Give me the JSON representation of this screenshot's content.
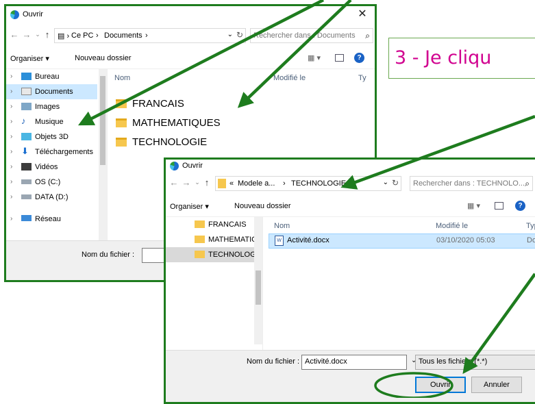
{
  "callout_text": "3 - Je cliqu",
  "dialog_back": {
    "title": "Ouvrir",
    "breadcrumb": [
      "Ce PC",
      "Documents"
    ],
    "search_placeholder": "Rechercher dans : Documents",
    "toolbar": {
      "organize": "Organiser ▾",
      "new_folder": "Nouveau dossier"
    },
    "nav_items": [
      {
        "label": "Bureau",
        "icon": "desktop-icon"
      },
      {
        "label": "Documents",
        "icon": "documents-icon",
        "selected": true
      },
      {
        "label": "Images",
        "icon": "pictures-icon"
      },
      {
        "label": "Musique",
        "icon": "music-icon"
      },
      {
        "label": "Objets 3D",
        "icon": "objects3d-icon"
      },
      {
        "label": "Téléchargements",
        "icon": "downloads-icon"
      },
      {
        "label": "Vidéos",
        "icon": "videos-icon"
      },
      {
        "label": "OS (C:)",
        "icon": "drive-icon"
      },
      {
        "label": "DATA (D:)",
        "icon": "drive-icon"
      },
      {
        "label": "Réseau",
        "icon": "network-icon"
      }
    ],
    "columns": {
      "name": "Nom",
      "modified": "Modifié le",
      "type": "Ty"
    },
    "folders": [
      "FRANCAIS",
      "MATHEMATIQUES",
      "TECHNOLOGIE"
    ],
    "footer": {
      "filename_label": "Nom du fichier :"
    }
  },
  "dialog_front": {
    "title": "Ouvrir",
    "breadcrumb": [
      "Modele a...",
      "TECHNOLOGIE"
    ],
    "search_placeholder": "Rechercher dans : TECHNOLO...",
    "toolbar": {
      "organize": "Organiser ▾",
      "new_folder": "Nouveau dossier"
    },
    "nav_items": [
      {
        "label": "FRANCAIS"
      },
      {
        "label": "MATHEMATIC"
      },
      {
        "label": "TECHNOLOG",
        "selected": true
      }
    ],
    "columns": {
      "name": "Nom",
      "modified": "Modifié le",
      "type": "Typ"
    },
    "files": [
      {
        "name": "Activité.docx",
        "modified": "03/10/2020 05:03",
        "type": "Do"
      }
    ],
    "footer": {
      "filename_label": "Nom du fichier :",
      "filename_value": "Activité.docx",
      "filter": "Tous les fichiers (*.*)",
      "open_button": "Ouvrir",
      "cancel_button": "Annuler"
    }
  },
  "colors": {
    "highlight_green": "#1e7c1e",
    "callout_text": "#d1008f",
    "selection": "#cce8ff"
  }
}
